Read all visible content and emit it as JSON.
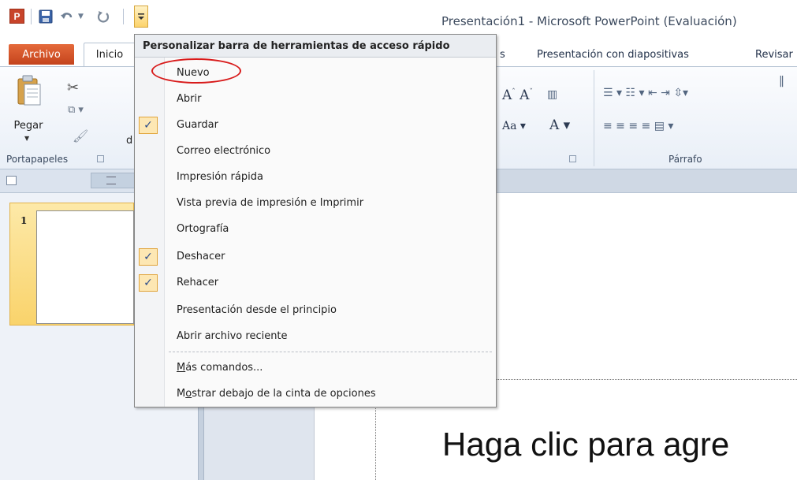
{
  "app": {
    "logo_letter": "P",
    "window_title": "Presentación1 - Microsoft PowerPoint (Evaluación)"
  },
  "ribbon": {
    "tabs": [
      "Archivo",
      "Inicio",
      "s",
      "Presentación con diapositivas",
      "Revisar"
    ],
    "paste_label": "Pegar",
    "clipboard_group": "Portapapeles",
    "paragraph_group": "Párrafo",
    "fragment_d": "d"
  },
  "menu": {
    "title": "Personalizar barra de herramientas de acceso rápido",
    "items": [
      {
        "label": "Nuevo",
        "checked": false
      },
      {
        "label": "Abrir",
        "checked": false
      },
      {
        "label": "Guardar",
        "checked": true
      },
      {
        "label": "Correo electrónico",
        "checked": false
      },
      {
        "label": "Impresión rápida",
        "checked": false
      },
      {
        "label": "Vista previa de impresión e Imprimir",
        "checked": false
      },
      {
        "label": "Ortografía",
        "checked": false
      },
      {
        "label": "Deshacer",
        "checked": true
      },
      {
        "label": "Rehacer",
        "checked": true
      },
      {
        "label": "Presentación desde el principio",
        "checked": false
      },
      {
        "label": "Abrir archivo reciente",
        "checked": false
      }
    ],
    "more_commands": {
      "pre": "",
      "ul": "M",
      "post": "ás comandos..."
    },
    "show_below": {
      "pre": "M",
      "ul": "o",
      "post": "strar debajo de la cinta de opciones"
    },
    "check_glyph": "✓"
  },
  "slides": {
    "thumbnail_number": "1",
    "placeholder_text": "Haga clic para agre"
  },
  "icons": {
    "save": "save-icon",
    "undo": "undo-icon",
    "redo": "redo-icon",
    "customize": "customize-qat-icon"
  }
}
